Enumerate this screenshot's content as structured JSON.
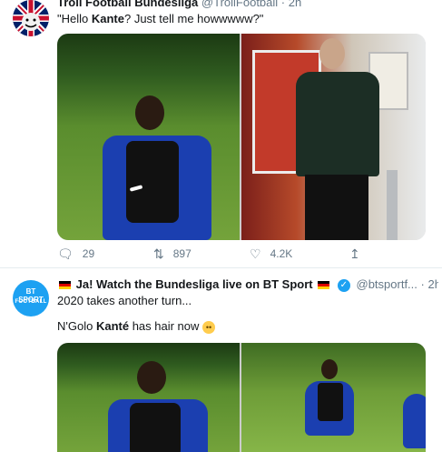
{
  "tweet1": {
    "header_name": "Troll Football Bundesliga",
    "header_handle": "@TrollFootball · 2h",
    "text_prefix": "\"Hello ",
    "text_bold": "Kante",
    "text_suffix": "? Just tell me howwwww?\"",
    "replies": "29",
    "retweets": "897",
    "likes": "4.2K"
  },
  "tweet2": {
    "name_prefix": "Ja! Watch the Bundesliga live on BT Sport",
    "handle": "@btsportf...",
    "time": "2h",
    "more": "···",
    "line1": "2020 takes another turn...",
    "line2_prefix": "N'Golo ",
    "line2_bold": "Kanté",
    "line2_suffix": " has hair now",
    "avatar_top": "BT SPORT",
    "avatar_bottom": "FOOTBALL"
  },
  "icons": {
    "reply": "reply-icon",
    "retweet": "retweet-icon",
    "like": "heart-icon",
    "share": "share-icon",
    "verified": "verified-badge-icon",
    "flag": "german-flag-icon",
    "emoji": "hushed-face-emoji"
  },
  "colors": {
    "accent": "#1da1f2",
    "muted": "#657786",
    "text": "#14171a",
    "divider": "#e6ecf0"
  }
}
